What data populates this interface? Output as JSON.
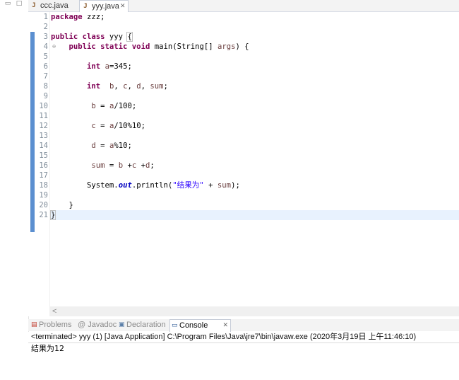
{
  "editor_tabs": [
    {
      "label": "ccc.java",
      "icon": "java-file-icon",
      "active": false
    },
    {
      "label": "yyy.java",
      "icon": "java-file-icon",
      "active": true,
      "close": "✕"
    }
  ],
  "editor": {
    "line_numbers": [
      "1",
      "2",
      "3",
      "4",
      "5",
      "6",
      "7",
      "8",
      "9",
      "10",
      "11",
      "12",
      "13",
      "14",
      "15",
      "16",
      "17",
      "18",
      "19",
      "20",
      "21"
    ],
    "fold_marker": "⊖",
    "lines": {
      "l1_kw": "package",
      "l1_rest": " zzz;",
      "l3_kw": "public class",
      "l3_rest": " yyy ",
      "l3_brace": "{",
      "l4_kw": "public static void",
      "l4_rest": " main(String[] ",
      "l4_arg": "args",
      "l4_end": ") {",
      "l6_kw": "int",
      "l6_var": "a",
      "l6_rest": "=345;",
      "l8_kw": "int",
      "l8_vars_b": "b",
      "l8_vars_c": "c",
      "l8_vars_d": "d",
      "l8_vars_sum": "sum",
      "l10_var": "b",
      "l10_mid": " = ",
      "l10_var2": "a",
      "l10_rest": "/100;",
      "l12_var": "c",
      "l12_mid": " = ",
      "l12_var2": "a",
      "l12_rest": "/10%10;",
      "l14_var": "d",
      "l14_mid": " = ",
      "l14_var2": "a",
      "l14_rest": "%10;",
      "l16_var": "sum",
      "l16_mid": " = ",
      "l16_b": "b",
      "l16_c": "c",
      "l16_d": "d",
      "l18_sys": "System.",
      "l18_out": "out",
      "l18_print": ".println(",
      "l18_str": "\"结果为\"",
      "l18_plus": " + ",
      "l18_sum": "sum",
      "l18_end": ");",
      "l20": "}",
      "l21": "}"
    },
    "scroll_arrow": "<"
  },
  "views": [
    {
      "label": "Problems",
      "icon": "problems-icon",
      "active": false
    },
    {
      "label": "@ Javadoc",
      "icon": "javadoc-icon",
      "active": false
    },
    {
      "label": "Declaration",
      "icon": "declaration-icon",
      "active": false
    },
    {
      "label": "Console",
      "icon": "console-icon",
      "active": true,
      "close": "✕"
    }
  ],
  "console": {
    "header": "<terminated> yyy (1) [Java Application] C:\\Program Files\\Java\\jre7\\bin\\javaw.exe (2020年3月19日 上午11:46:10)",
    "output": "结果为12"
  },
  "colors": {
    "keyword": "#7f0055",
    "string": "#2a00ff",
    "field": "#0000c0",
    "variable": "#6a3e3e"
  }
}
